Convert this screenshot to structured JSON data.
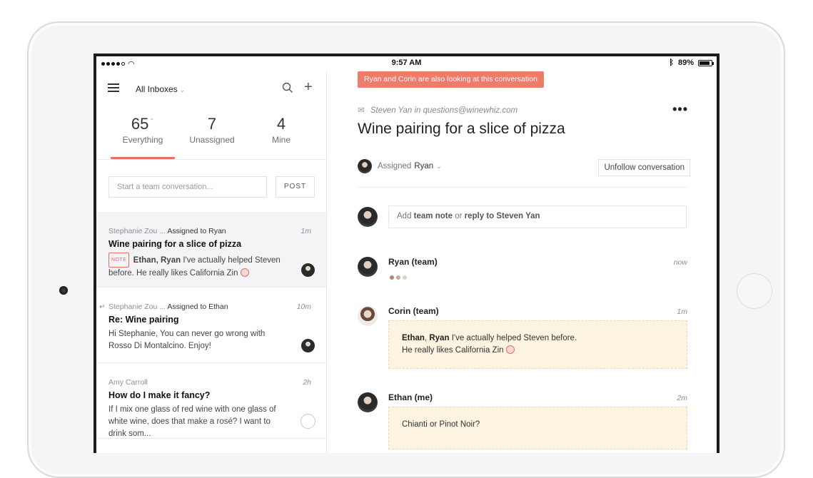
{
  "status_bar": {
    "time": "9:57 AM",
    "battery": "89%",
    "battery_level": 0.89
  },
  "left": {
    "inbox_select": "All Inboxes",
    "stats": [
      {
        "num": "65",
        "label": "Everything"
      },
      {
        "num": "7",
        "label": "Unassigned"
      },
      {
        "num": "4",
        "label": "Mine"
      }
    ],
    "compose_placeholder": "Start a team conversation...",
    "post_label": "POST",
    "conversations": [
      {
        "sender": "Stephanie Zou ...",
        "assignment": "Assigned to Ryan",
        "time": "1m",
        "subject": "Wine pairing for a slice of pizza",
        "note_tag": "NOTE",
        "preview_bold": "Ethan, Ryan",
        "preview": "I've actually helped Steven before. He really likes California Zin"
      },
      {
        "sender": "Stephanie Zou ...",
        "assignment": "Assigned to Ethan",
        "time": "10m",
        "subject": "Re: Wine pairing",
        "preview": "Hi Stephanie, You can never go wrong with Rosso Di Montalcino. Enjoy!"
      },
      {
        "sender": "Amy Carroll",
        "time": "2h",
        "subject": "How do I make it fancy?",
        "preview": "If I mix one glass of red wine with one glass of white wine, does that make a rosé? I want to drink som..."
      }
    ]
  },
  "right": {
    "banner": "Ryan and Corin are also looking at this conversation",
    "from_name": "Steven Yan",
    "from_in": "in",
    "from_email": "questions@winewhiz.com",
    "title": "Wine pairing for a slice of pizza",
    "assigned_prefix": "Assigned",
    "assigned_name": "Ryan",
    "unfollow_label": "Unfollow conversation",
    "reply_prefix": "Add",
    "reply_team_note": "team note",
    "reply_or": "or",
    "reply_to": "reply to Steven Yan",
    "messages": [
      {
        "who": "Ryan (team)",
        "when": "now"
      },
      {
        "who": "Corin (team)",
        "when": "1m",
        "body_bold_1": "Ethan",
        "body_sep": ",",
        "body_bold_2": "Ryan",
        "body_line1": "I've actually helped Steven before.",
        "body_line2": "He really likes California Zin"
      },
      {
        "who": "Ethan (me)",
        "when": "2m",
        "body": "Chianti or Pinot Noir?"
      }
    ]
  },
  "colors": {
    "accent": "#e8705e",
    "banner": "#ef7b6b",
    "note_bg": "#fcf4e1"
  },
  "icons": [
    "menu-icon",
    "search-icon",
    "plus-icon",
    "mail-icon",
    "more-icon",
    "reply-arrow-icon",
    "chevron-down-icon"
  ]
}
